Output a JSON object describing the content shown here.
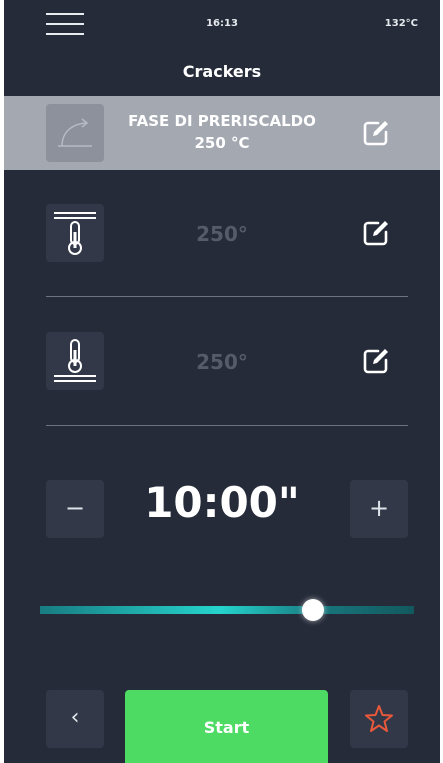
{
  "status_bar": {
    "time": "16:13",
    "oven_temperature": "132°C"
  },
  "title": "Crackers",
  "phase": {
    "line1": "FASE DI PRERISCALDO",
    "line2": "250 °C"
  },
  "top_heat": {
    "temperature": "250°"
  },
  "bottom_heat": {
    "temperature": "250°"
  },
  "timer": {
    "value": "10:00\"",
    "minus_label": "−",
    "plus_label": "+"
  },
  "slider": {
    "level": 0.73
  },
  "footer": {
    "back_label": "‹",
    "start_label": "Start"
  },
  "colors": {
    "background": "#252b39",
    "phase_bar": "#a3a8b1",
    "start": "#4ddb64",
    "slider_accent": "#26d4cd",
    "favorite": "#e8583a"
  },
  "icons": [
    "menu-icon",
    "curve-icon",
    "edit-icon",
    "top-heat-thermometer-icon",
    "bottom-heat-thermometer-icon",
    "chevron-left-icon",
    "star-icon"
  ]
}
